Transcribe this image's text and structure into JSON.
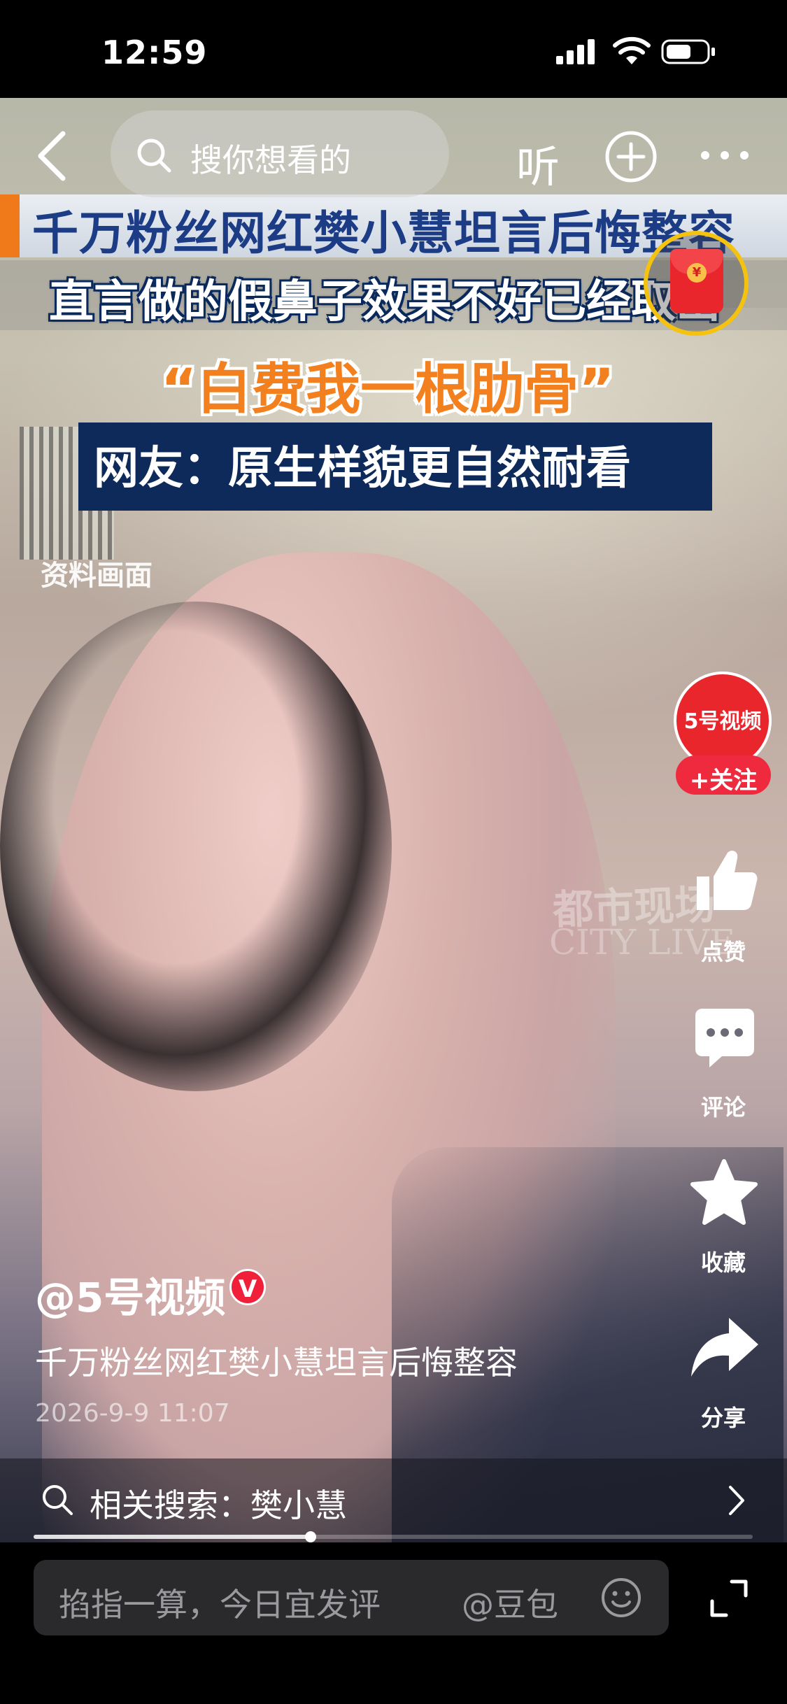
{
  "status_bar": {
    "time": "12:59"
  },
  "top_nav": {
    "search_placeholder": "搜你想看的",
    "listen_label": "听"
  },
  "video_overlay": {
    "headline": "千万粉丝网红樊小慧坦言后悔整容",
    "subline": "直言做的假鼻子效果不好已经取出",
    "quote": "“白费我一根肋骨”",
    "netizen_comment": "网友：原生样貌更自然耐看",
    "archive_label": "资料画面",
    "watermark_cn": "都市现场",
    "watermark_en": "CITY LIVE"
  },
  "author": {
    "handle": "@5号视频",
    "avatar_text": "5号视频",
    "follow_label": "+关注",
    "verified_badge": "V"
  },
  "actions": {
    "like_label": "点赞",
    "comment_label": "评论",
    "collect_label": "收藏",
    "share_label": "分享"
  },
  "caption": {
    "title": "千万粉丝网红樊小慧坦言后悔整容",
    "timestamp": "2026-9-9 11:07"
  },
  "related_search": {
    "label": "相关搜索：樊小慧"
  },
  "progress": {
    "fraction": 0.385
  },
  "bottom_bar": {
    "comment_placeholder": "掐指一算，今日宜发评",
    "mention_label": "@豆包"
  },
  "colors": {
    "follow_red": "#f02a3e",
    "headline_blue": "#1c3c86",
    "quote_orange": "#f3801e",
    "red_packet_ring": "#f5c30f"
  },
  "icons": [
    "back-icon",
    "search-icon",
    "add-icon",
    "more-icon",
    "red-packet-icon",
    "like-icon",
    "comment-icon",
    "collect-icon",
    "share-icon",
    "chevron-right-icon",
    "emoji-icon",
    "fullscreen-icon"
  ]
}
